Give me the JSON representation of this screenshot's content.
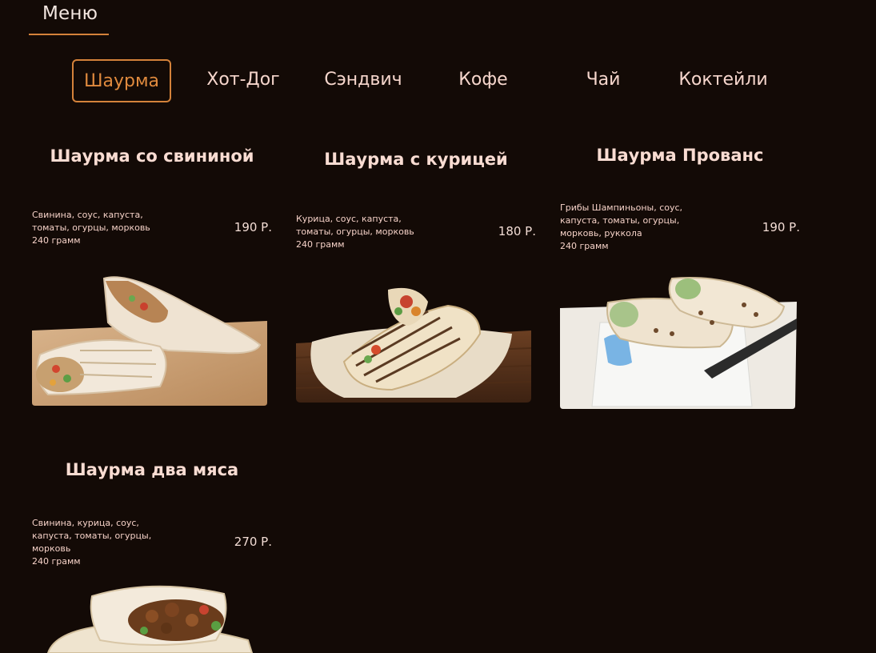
{
  "header": {
    "title": "Меню"
  },
  "tabs": [
    {
      "label": "Шаурма",
      "active": true
    },
    {
      "label": "Хот-Дог",
      "active": false
    },
    {
      "label": "Сэндвич",
      "active": false
    },
    {
      "label": "Кофе",
      "active": false
    },
    {
      "label": "Чай",
      "active": false
    },
    {
      "label": "Коктейли",
      "active": false
    }
  ],
  "items": [
    {
      "title": "Шаурма со свининой",
      "desc_lines": [
        "Свинина, соус, капуста,",
        "томаты, огурцы, морковь",
        "240 грамм"
      ],
      "price": "190 Р."
    },
    {
      "title": "Шаурма с курицей",
      "desc_lines": [
        "Курица, соус, капуста,",
        "томаты, огурцы, морковь",
        "240 грамм"
      ],
      "price": "180 Р."
    },
    {
      "title": "Шаурма Прованс",
      "desc_lines": [
        "Грибы Шампиньоны, соус,",
        "капуста, томаты, огурцы,",
        "морковь, руккола",
        "240 грамм"
      ],
      "price": "190 Р."
    },
    {
      "title": "Шаурма два мяса",
      "desc_lines": [
        "Свинина, курица, соус,",
        "капуста, томаты, огурцы,",
        "морковь",
        "240 грамм"
      ],
      "price": "270 Р."
    }
  ],
  "colors": {
    "background": "#130a06",
    "accent": "#d4823a",
    "text": "#f6d6cc"
  }
}
